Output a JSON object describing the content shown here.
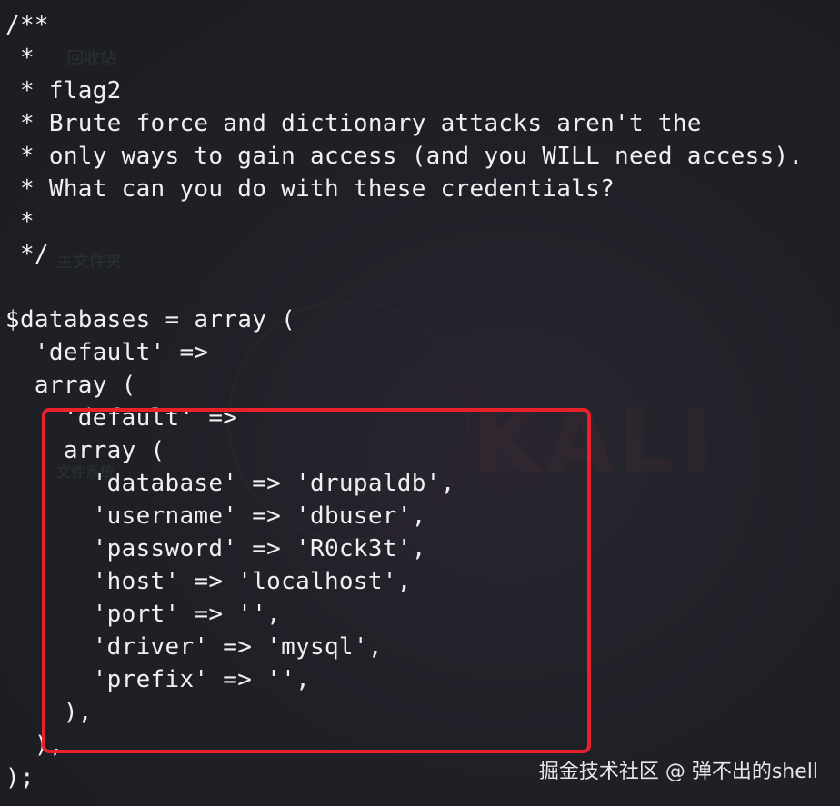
{
  "background_ghost": {
    "recycle_bin_label": "回收站",
    "home_folder_label": "主文件夹",
    "file_system_label": "文件系统",
    "desktop_logo_text": "KALI"
  },
  "code_lines": [
    "/**",
    " *",
    " * flag2",
    " * Brute force and dictionary attacks aren't the",
    " * only ways to gain access (and you WILL need access).",
    " * What can you do with these credentials?",
    " *",
    " */",
    "",
    "$databases = array (",
    "  'default' =>",
    "  array (",
    "    'default' =>",
    "    array (",
    "      'database' => 'drupaldb',",
    "      'username' => 'dbuser',",
    "      'password' => 'R0ck3t',",
    "      'host' => 'localhost',",
    "      'port' => '',",
    "      'driver' => 'mysql',",
    "      'prefix' => '',",
    "    ),",
    "  ),",
    ");"
  ],
  "highlight_color": "#e8212b",
  "text_color": "#eef0f2",
  "background_color": "#1d1f24",
  "watermark": "掘金技术社区 @ 弹不出的shell"
}
